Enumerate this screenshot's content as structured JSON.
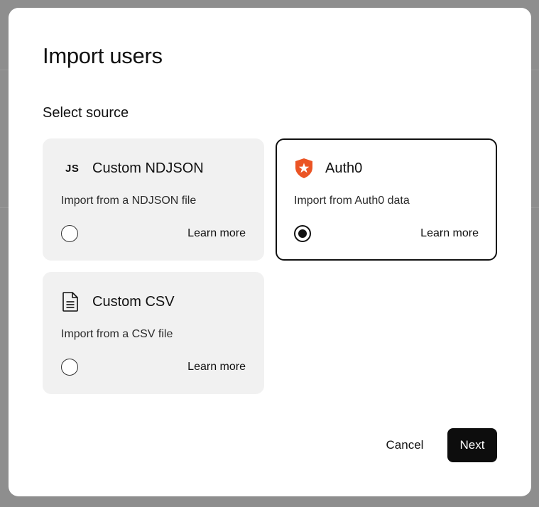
{
  "modal": {
    "title": "Import users",
    "section_label": "Select source"
  },
  "sources": [
    {
      "icon": "js-icon",
      "icon_text": "JS",
      "title": "Custom NDJSON",
      "description": "Import from a NDJSON file",
      "selected": false,
      "learn_more": "Learn more"
    },
    {
      "icon": "auth0-icon",
      "title": "Auth0",
      "description": "Import from Auth0 data",
      "selected": true,
      "learn_more": "Learn more"
    },
    {
      "icon": "document-icon",
      "title": "Custom CSV",
      "description": "Import from a CSV file",
      "selected": false,
      "learn_more": "Learn more"
    }
  ],
  "actions": {
    "cancel_label": "Cancel",
    "next_label": "Next"
  },
  "colors": {
    "auth0_brand": "#eb5424",
    "primary_button": "#0d0d0d",
    "card_background": "#f1f1f1"
  }
}
